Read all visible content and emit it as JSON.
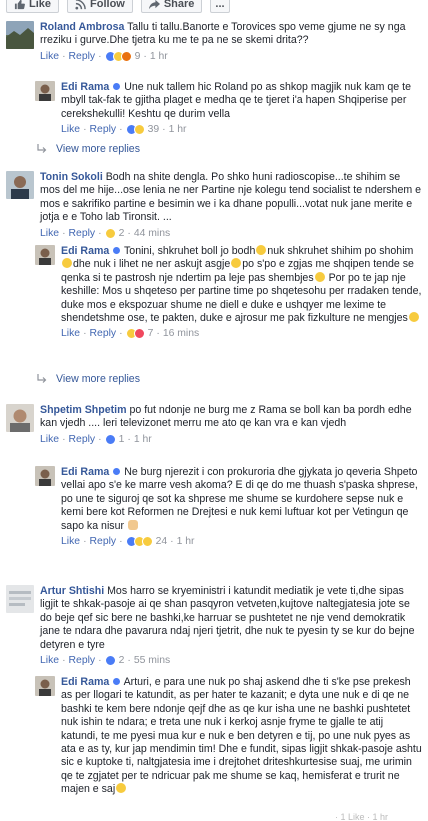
{
  "toolbar": {
    "like": "Like",
    "follow": "Follow",
    "share": "Share",
    "more": "..."
  },
  "view_more_replies": "View more replies",
  "actions": {
    "like": "Like",
    "reply": "Reply"
  },
  "comments": [
    {
      "author": "Roland Ambrosa",
      "text": "Tallu ti tallu.Banorte e Torovices spo veme gjume ne sy nga rreziku i gurve.Dhe tjetra ku me te pa ne se skemi drita??",
      "count": "9",
      "time": "1 hr",
      "reply": {
        "author": "Edi Rama",
        "text": "Une nuk tallem hic Roland po as shkop magjik nuk kam qe te mbyll tak-fak te gjitha plaget e medha qe te tjeret i'a hapen Shqiperise per cerekshekulli! Keshtu qe durim vella",
        "count": "39",
        "time": "1 hr"
      }
    },
    {
      "author": "Tonin Sokoli",
      "text": "Bodh na shite dengla. Po shko huni radioscopise...te shihim se mos del me hije...ose lenia ne ner Partine nje kolegu tend socialist te ndershem e mos e sakrifiko partine e besimin we i ka dhane populli...votat nuk jane merite e jotja e e Toho lab Tironsit. ...",
      "count": "2",
      "time": "44 mins",
      "reply": {
        "author": "Edi Rama",
        "text_a": "Tonini, shkruhet boll jo bodh",
        "text_b": "nuk shkruhet shihim po shohim",
        "text_c": "dhe nuk i lihet ne ner askujt asgje",
        "text_d": "po s'po e zgjas me shqipen tende se qenka si te pastrosh nje ndertim pa leje pas shembjes",
        "text_e": "Por po te jap nje keshille: Mos u shqeteso per partine time po shqetesohu per rradaken tende, duke mos e ekspozuar shume ne diell e duke e ushqyer me lexime te shendetshme ose, te pakten, duke e ajrosur me pak fizkulture ne mengjes",
        "count": "7",
        "time": "16 mins"
      }
    },
    {
      "author": "Shpetim Shpetim",
      "text": "po fut ndonje ne burg me z Rama se boll kan ba pordh edhe kan vjedh .... leri televizonet merru me ato qe kan vra e kan vjedh",
      "count": "1",
      "time": "1 hr",
      "reply": {
        "author": "Edi Rama",
        "text": "Ne burg njerezit i con prokuroria dhe gjykata jo qeveria Shpeto vellai apo s'e ke marre vesh akoma? E di qe do me thuash s'paska shprese, po une te siguroj qe sot ka shprese me shume se kurdohere sepse nuk e kemi bere kot Reformen ne Drejtesi e nuk kemi luftuar kot per Vetingun qe sapo ka nisur",
        "count": "24",
        "time": "1 hr"
      }
    },
    {
      "author": "Artur Shtishi",
      "text": "Mos harro se kryeministri i katundit mediatik je vete ti,dhe sipas ligjit te shkak-pasoje ai qe shan pasqyron vetveten,kujtove naltegjatesia jote se do beje qef sic bere ne bashki,ke harruar se pushtetet ne nje vend demokratik jane te ndara dhe pavarura ndaj njeri tjetrit, dhe nuk te pyesin ty se kur do bejne detyren e tyre",
      "count": "2",
      "time": "55 mins",
      "reply": {
        "author": "Edi Rama",
        "text": "Arturi, e para une nuk po shaj askend dhe ti s'ke pse prekesh as per llogari te katundit, as per hater te kazanit; e dyta une nuk e di qe ne bashki te kem bere ndonje qejf dhe as qe kur isha une ne bashki pushtetet nuk ishin te ndara; e treta une nuk i kerkoj asnje fryme te gjalle te atij katundi, te me pyesi mua kur e nuk e ben detyren e tij, po une nuk pyes as ata e as ty, kur jap mendimin tim! Dhe e fundit, sipas ligjit shkak-pasoje ashtu sic e kuptoke ti, naltgjatesia ime i drejtohet driteshkurtesise suaj, me urimin qe te zgjatet per te ndricuar pak me shume se kaq, hemisferat e trurit ne majen e saj"
      }
    }
  ],
  "bottom_fragment": "· 1 Like · 1 hr"
}
